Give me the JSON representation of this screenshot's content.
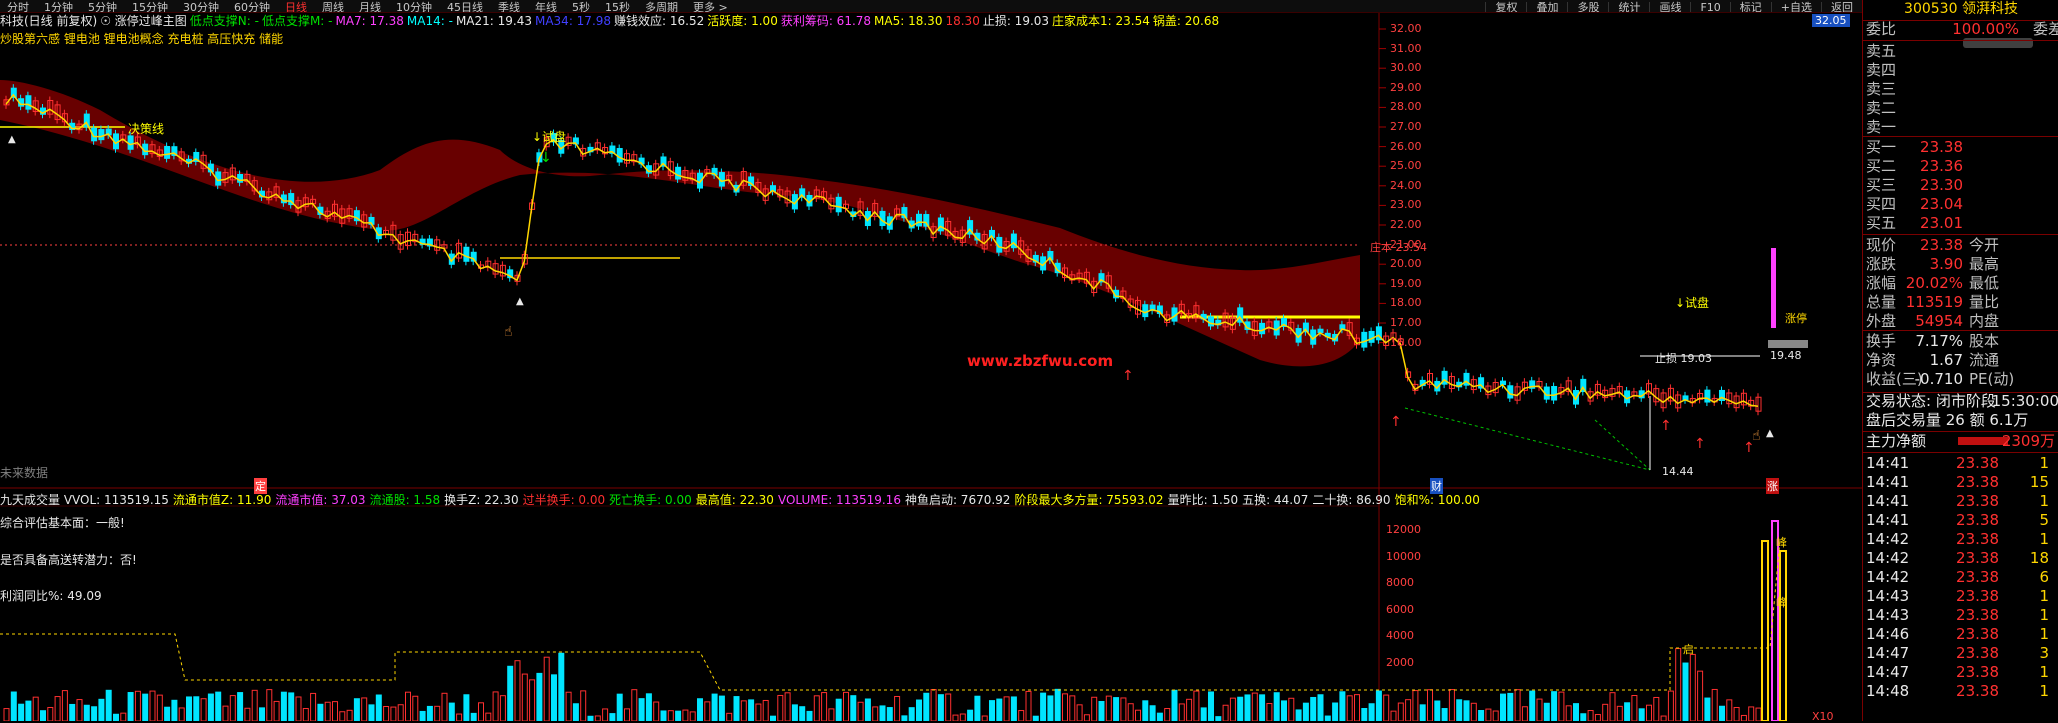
{
  "toolbar": {
    "periods": [
      "分时",
      "1分钟",
      "5分钟",
      "15分钟",
      "30分钟",
      "60分钟",
      "日线",
      "周线",
      "月线",
      "10分钟",
      "45日线",
      "季线",
      "年线",
      "5秒",
      "15秒",
      "多周期",
      "更多 >"
    ],
    "active_period": "日线",
    "tools": [
      "复权",
      "叠加",
      "多股",
      "统计",
      "画线",
      "F10",
      "标记",
      "+自选",
      "返回"
    ]
  },
  "info_row": [
    {
      "text": "科技(日线 前复权)",
      "color": "#e8e8e8"
    },
    {
      "text": "☉ 涨停过峰主图",
      "color": "#e8e8e8"
    },
    {
      "text": "低点支撑N: -",
      "color": "#00e000"
    },
    {
      "text": "低点支撑M: -",
      "color": "#00e000"
    },
    {
      "text": "MA7: 17.38",
      "color": "#ff40ff"
    },
    {
      "text": "MA14: -",
      "color": "#00ffff"
    },
    {
      "text": "MA21: 19.43",
      "color": "#e8e8e8"
    },
    {
      "text": "MA34: 17.98",
      "color": "#4040ff"
    },
    {
      "text": "赚钱效应: 16.52",
      "color": "#e8e8e8"
    },
    {
      "text": "活跃度: 1.00",
      "color": "#ffff00"
    },
    {
      "text": "获利筹码: 61.78",
      "color": "#ff40ff"
    },
    {
      "text": "MA5: 18.30",
      "color": "#ffff00"
    },
    {
      "text": "18.30",
      "color": "#ff3030"
    },
    {
      "text": "止损: 19.03",
      "color": "#e8e8e8"
    },
    {
      "text": "庄家成本1: 23.54",
      "color": "#ffff00"
    },
    {
      "text": "锅盖: 20.68",
      "color": "#ffff00"
    }
  ],
  "concept_row": "炒股第六感 锂电池 锂电池概念 充电桩 高压快充 储能",
  "price_axis": {
    "ticks": [
      "32.00",
      "31.00",
      "30.00",
      "29.00",
      "28.00",
      "27.00",
      "26.00",
      "25.00",
      "24.00",
      "23.00",
      "22.00",
      "21.00",
      "20.00",
      "19.00",
      "18.00",
      "17.00",
      "16.00"
    ],
    "current_tag": "32.05",
    "stop_tag": "19.48"
  },
  "annotations": {
    "decision_line": "决策线",
    "trial_1": "↓试盘",
    "trial_2": "↓试盘",
    "dealer_cost": "庄本 23.54",
    "stop_loss": "止损 19.03",
    "low_price": "14.44",
    "watermark": "www.zbzfwu.com",
    "rise_stop": "涨停",
    "future_data": "未来数据",
    "mark_ding": "定",
    "mark_cai": "财",
    "mark_zhang": "涨",
    "mark_tong": "峰",
    "mark_tong2": "峰",
    "mark_qi": "启"
  },
  "volume_legend": [
    {
      "text": "九天成交量 VVOL: 113519.15",
      "color": "#e8e8e8"
    },
    {
      "text": "流通市值Z: 11.90",
      "color": "#ffff00"
    },
    {
      "text": "流通市值: 37.03",
      "color": "#ff40ff"
    },
    {
      "text": "流通股: 1.58",
      "color": "#00e000"
    },
    {
      "text": "换手Z: 22.30",
      "color": "#e8e8e8"
    },
    {
      "text": "过半换手: 0.00",
      "color": "#ff3030"
    },
    {
      "text": "死亡换手: 0.00",
      "color": "#00e000"
    },
    {
      "text": "最高值: 22.30",
      "color": "#ffff00"
    },
    {
      "text": "VOLUME: 113519.16",
      "color": "#ff40ff"
    },
    {
      "text": "神鱼启动: 7670.92",
      "color": "#e8e8e8"
    },
    {
      "text": "阶段最大多方量: 75593.02",
      "color": "#ffff00"
    },
    {
      "text": "量昨比: 1.50",
      "color": "#e8e8e8"
    },
    {
      "text": "五换: 44.07",
      "color": "#e8e8e8"
    },
    {
      "text": "二十换: 86.90",
      "color": "#e8e8e8"
    },
    {
      "text": "饱和%: 100.00",
      "color": "#ffff00"
    }
  ],
  "fundamentals": [
    "综合评估基本面：一般!",
    "是否具备高送转潜力：否!",
    "利润同比%: 49.09"
  ],
  "volume_axis": {
    "ticks": [
      "12000",
      "10000",
      "8000",
      "6000",
      "4000",
      "2000"
    ],
    "unit": "X10"
  },
  "quote_panel": {
    "code": "300530",
    "name": "领湃科技",
    "weibi_label": "委比",
    "weibi_value": "100.00%",
    "weicha_label": "委差",
    "asks": [
      {
        "label": "卖五",
        "price": ""
      },
      {
        "label": "卖四",
        "price": ""
      },
      {
        "label": "卖三",
        "price": ""
      },
      {
        "label": "卖二",
        "price": ""
      },
      {
        "label": "卖一",
        "price": ""
      }
    ],
    "bids": [
      {
        "label": "买一",
        "price": "23.38"
      },
      {
        "label": "买二",
        "price": "23.36"
      },
      {
        "label": "买三",
        "price": "23.30"
      },
      {
        "label": "买四",
        "price": "23.04"
      },
      {
        "label": "买五",
        "price": "23.01"
      }
    ],
    "stats": [
      {
        "l1": "现价",
        "v1": "23.38",
        "l2": "今开"
      },
      {
        "l1": "涨跌",
        "v1": "3.90",
        "l2": "最高"
      },
      {
        "l1": "涨幅",
        "v1": "20.02%",
        "l2": "最低"
      },
      {
        "l1": "总量",
        "v1": "113519",
        "l2": "量比"
      },
      {
        "l1": "外盘",
        "v1": "54954",
        "l2": "内盘"
      }
    ],
    "stats2": [
      {
        "l1": "换手",
        "v1": "7.17%",
        "l2": "股本"
      },
      {
        "l1": "净资",
        "v1": "1.67",
        "l2": "流通"
      },
      {
        "l1": "收益(三)",
        "v1": "-0.710",
        "l2": "PE(动)"
      }
    ],
    "trade_status": "交易状态: 闭市阶段",
    "trade_time": "15:30:00",
    "after_hours": "盘后交易量 26 额 6.1万",
    "main_net_label": "主力净额",
    "main_net_value": "2309万",
    "ticks": [
      {
        "t": "14:41",
        "p": "23.38",
        "v": "1"
      },
      {
        "t": "14:41",
        "p": "23.38",
        "v": "15"
      },
      {
        "t": "14:41",
        "p": "23.38",
        "v": "1"
      },
      {
        "t": "14:41",
        "p": "23.38",
        "v": "5"
      },
      {
        "t": "14:42",
        "p": "23.38",
        "v": "1"
      },
      {
        "t": "14:42",
        "p": "23.38",
        "v": "18"
      },
      {
        "t": "14:42",
        "p": "23.38",
        "v": "6"
      },
      {
        "t": "14:43",
        "p": "23.38",
        "v": "1"
      },
      {
        "t": "14:43",
        "p": "23.38",
        "v": "1"
      },
      {
        "t": "14:46",
        "p": "23.38",
        "v": "1"
      },
      {
        "t": "14:47",
        "p": "23.38",
        "v": "3"
      },
      {
        "t": "14:47",
        "p": "23.38",
        "v": "1"
      },
      {
        "t": "14:48",
        "p": "23.38",
        "v": "1"
      }
    ]
  },
  "colors": {
    "up": "#ff3030",
    "down": "#00e5ff",
    "band": "#8b0000",
    "axis_line": "#7a0000",
    "yellow": "#ffff00"
  }
}
